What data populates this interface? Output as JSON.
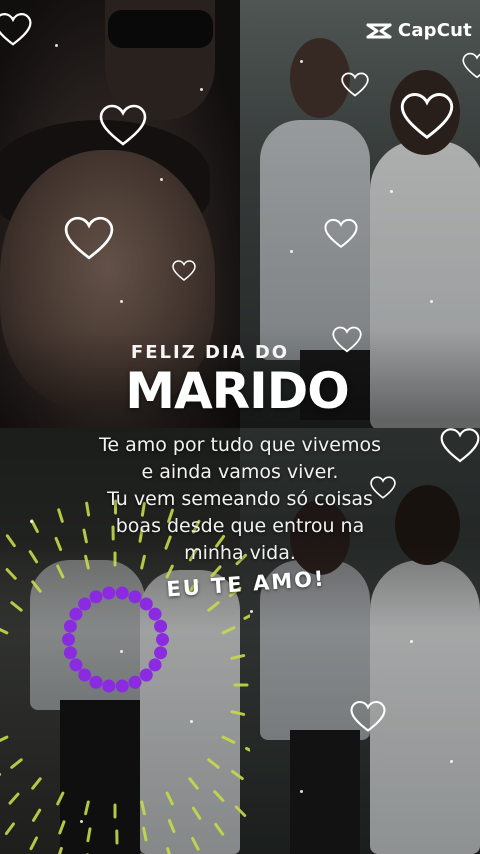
{
  "watermark": {
    "icon": "capcut-logo-icon",
    "text": "CapCut"
  },
  "overlay": {
    "subtitle": "FELIZ DIA DO",
    "headline": "MARIDO",
    "message_lines": [
      "Te amo por tudo que vivemos",
      "e ainda vamos viver.",
      "Tu vem semeando só coisas",
      "boas desde que entrou na",
      "minha vida."
    ],
    "closing": "EU TE AMO!"
  },
  "colors": {
    "text": "#ffffff",
    "accent_purple": "#8a2be2",
    "burst_yellow": "#c8d94a"
  },
  "decorations": {
    "hearts_icon": "heart-outline-icon",
    "ring_icon": "purple-dotted-ring-icon",
    "burst_icon": "sunburst-rays-icon"
  }
}
